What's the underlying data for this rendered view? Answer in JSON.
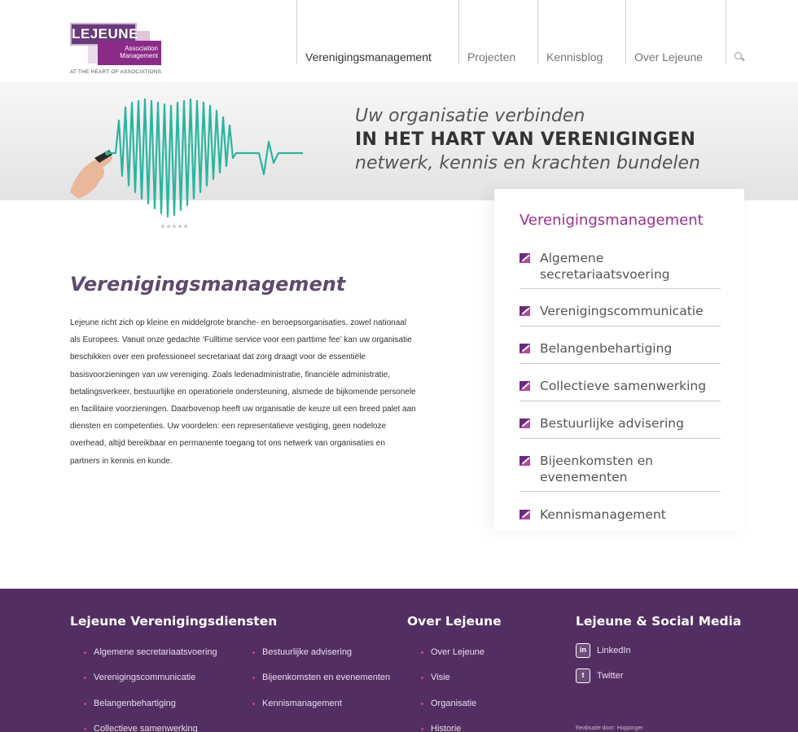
{
  "logo": {
    "name": "LEJEUNE",
    "sub_line1": "Association",
    "sub_line2": "Management",
    "tagline": "AT THE HEART OF ASSOCIATIONS"
  },
  "nav": {
    "items": [
      {
        "label": "Verenigingsmanagement"
      },
      {
        "label": "Projecten"
      },
      {
        "label": "Kennisblog"
      },
      {
        "label": "Over Lejeune"
      }
    ],
    "search_icon": "search-icon"
  },
  "hero": {
    "line1": "Uw organisatie verbinden",
    "line2": "IN HET HART VAN VERENIGINGEN",
    "line3": "netwerk, kennis en krachten bundelen"
  },
  "main": {
    "title": "Verenigingsmanagement",
    "body": "Lejeune richt zich op kleine en middelgrote branche- en beroepsorganisaties, zowel nationaal als Europees. Vanuit onze gedachte ‘Fulltime service voor een parttime fee’ kan uw organisatie beschikken over een professioneel secretariaat dat zorg draagt voor de essentiële basisvoorzieningen van uw vereniging. Zoals ledenadministratie, financiële administratie, betalingsverkeer, bestuurlijke en operationele ondersteuning, alsmede de bijkomende personele en facilitaire voorzieningen. Daarbovenop heeft uw organisatie de keuze uit een breed palet aan diensten en competenties. Uw voordelen: een representatieve vestiging, geen nodeloze overhead, altijd bereikbaar en permanente toegang tot ons netwerk van organisaties en partners in kennis en kunde."
  },
  "sidebar": {
    "title": "Verenigingsmanagement",
    "items": [
      {
        "label": "Algemene secretariaatsvoering"
      },
      {
        "label": "Verenigingscommunicatie"
      },
      {
        "label": "Belangenbehartiging"
      },
      {
        "label": "Collectieve samenwerking"
      },
      {
        "label": "Bestuurlijke advisering"
      },
      {
        "label": "Bijeenkomsten en evenementen"
      },
      {
        "label": "Kennismanagement"
      }
    ]
  },
  "footer": {
    "col1_title": "Lejeune Verenigingsdiensten",
    "col1_links": [
      "Algemene secretariaatsvoering",
      "Verenigingscommunicatie",
      "Belangenbehartiging",
      "Collectieve samenwerking",
      "Bestuurlijke advisering",
      "Bijeenkomsten en evenementen",
      "Kennismanagement"
    ],
    "col2_title": "Over Lejeune",
    "col2_links": [
      "Over Lejeune",
      "Visie",
      "Organisatie",
      "Historie"
    ],
    "col3_title": "Lejeune & Social Media",
    "social": [
      {
        "label": "LinkedIn",
        "icon": "linkedin-icon",
        "glyph": "in"
      },
      {
        "label": "Twitter",
        "icon": "twitter-icon",
        "glyph": "t"
      }
    ],
    "credit": "Realisatie door: Hoppinger"
  },
  "colors": {
    "brand_purple": "#532e62",
    "accent_magenta": "#9b2f8f",
    "heartbeat_teal": "#2bb5a0"
  }
}
